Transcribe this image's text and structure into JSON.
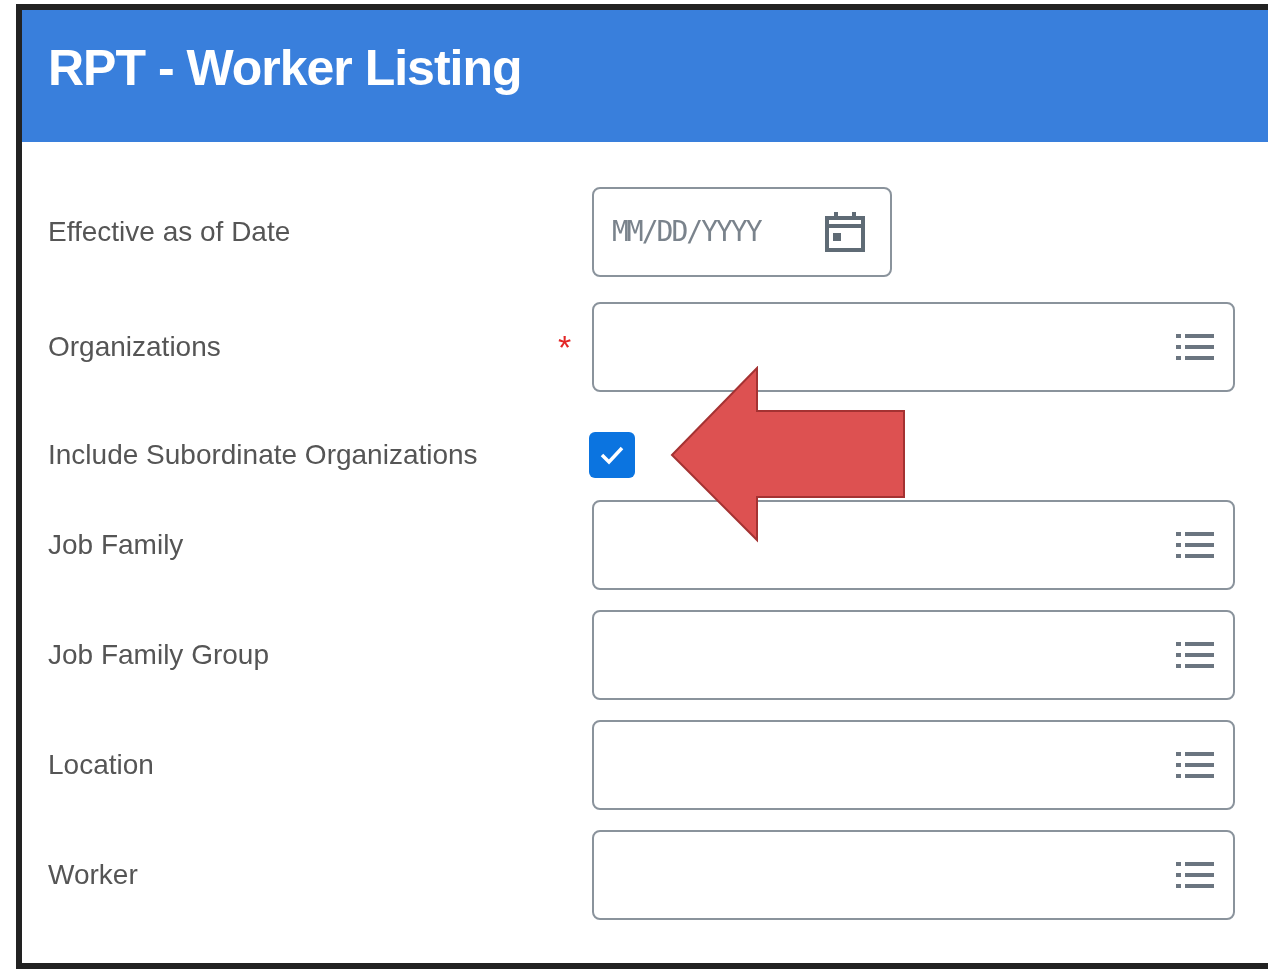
{
  "window": {
    "title": "RPT - Worker Listing"
  },
  "required_mark": "*",
  "fields": [
    {
      "label": "Effective as of Date",
      "kind": "date",
      "required": false,
      "placeholder": "MM/DD/YYYY"
    },
    {
      "label": "Organizations",
      "kind": "prompt",
      "required": true
    },
    {
      "label": "Include Subordinate Organizations",
      "kind": "checkbox",
      "required": false,
      "checked": true
    },
    {
      "label": "Job Family",
      "kind": "prompt",
      "required": false
    },
    {
      "label": "Job Family Group",
      "kind": "prompt",
      "required": false
    },
    {
      "label": "Location",
      "kind": "prompt",
      "required": false
    },
    {
      "label": "Worker",
      "kind": "prompt",
      "required": false
    }
  ]
}
